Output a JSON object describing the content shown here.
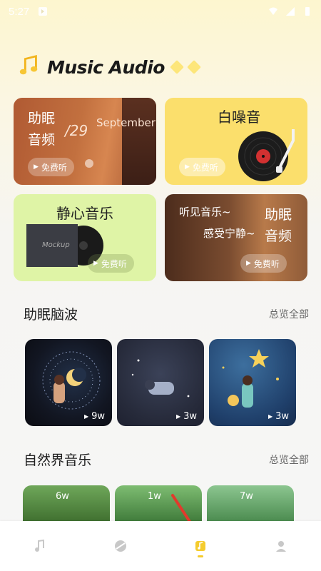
{
  "status_bar": {
    "time": "5:27"
  },
  "app": {
    "title": "Music Audio"
  },
  "cards": [
    {
      "title_line1": "助眠",
      "title_line2": "音频",
      "date": "/29",
      "month": "September",
      "cta": "免费听"
    },
    {
      "title": "白噪音",
      "cta": "免费听"
    },
    {
      "title": "静心音乐",
      "album_text": "Mockup",
      "cta": "免费听"
    },
    {
      "title_a": "听见音乐~",
      "title_b": "感受宁静~",
      "title_line1": "助眠",
      "title_line2": "音频",
      "cta": "免费听"
    }
  ],
  "sections": [
    {
      "title": "助眠脑波",
      "more": "总览全部",
      "items": [
        {
          "count": "9w"
        },
        {
          "count": "3w"
        },
        {
          "count": "3w"
        }
      ]
    },
    {
      "title": "自然界音乐",
      "more": "总览全部",
      "items": [
        {
          "count": "6w"
        },
        {
          "count": "1w"
        },
        {
          "count": "7w"
        }
      ]
    }
  ],
  "tabbar": {
    "active_index": 2,
    "accent_color": "#f5cc2e",
    "tabs": [
      {
        "icon": "music-note-icon"
      },
      {
        "icon": "disc-icon"
      },
      {
        "icon": "music-library-icon"
      },
      {
        "icon": "profile-icon"
      }
    ]
  }
}
